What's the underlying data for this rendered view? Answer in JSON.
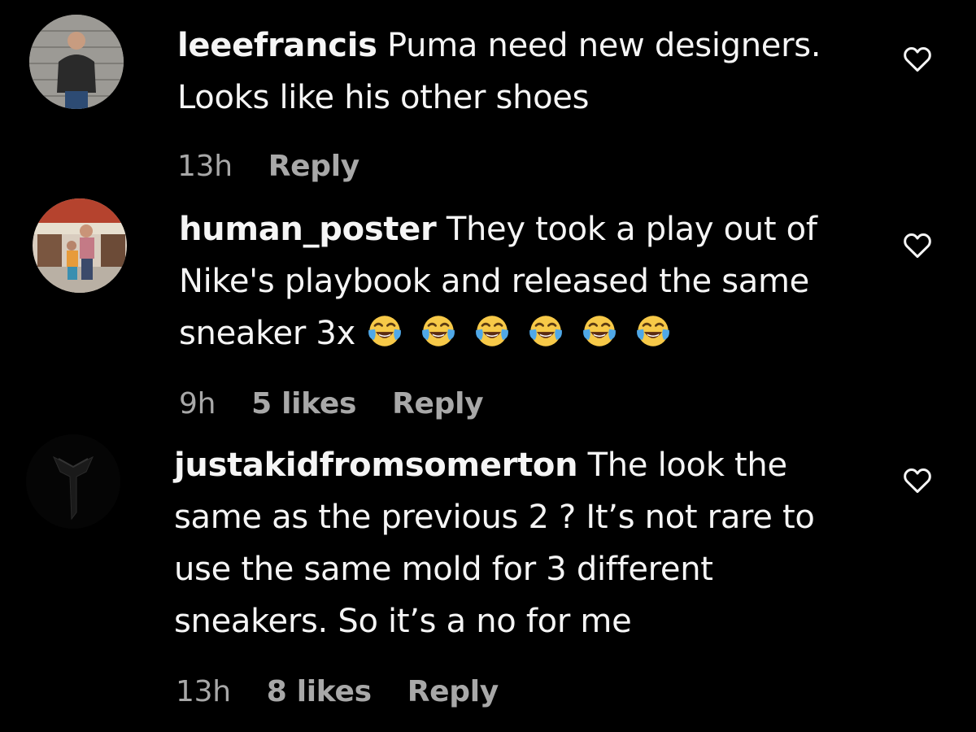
{
  "comments": [
    {
      "username": "leeefrancis",
      "text": " Puma need new designers. Looks like his other shoes",
      "time": "13h",
      "likes": "",
      "reply_label": "Reply"
    },
    {
      "username": "human_poster",
      "text": " They took a play out of Nike's playbook and released the same sneaker 3x",
      "emoji_count": 6,
      "emoji_name": "face-with-tears-of-joy-icon",
      "time": "9h",
      "likes": "5 likes",
      "reply_label": "Reply"
    },
    {
      "username": "justakidfromsomerton",
      "text": " The look the same as the previous 2 ? It’s not rare to use the same mold for 3 different sneakers. So it’s a no for me",
      "time": "13h",
      "likes": "8 likes",
      "reply_label": "Reply"
    }
  ],
  "colors": {
    "background": "#000000",
    "text": "#f5f5f5",
    "meta": "#a8a8a8",
    "emoji_yellow": "#f7c948",
    "emoji_tear": "#4fa8e8"
  }
}
